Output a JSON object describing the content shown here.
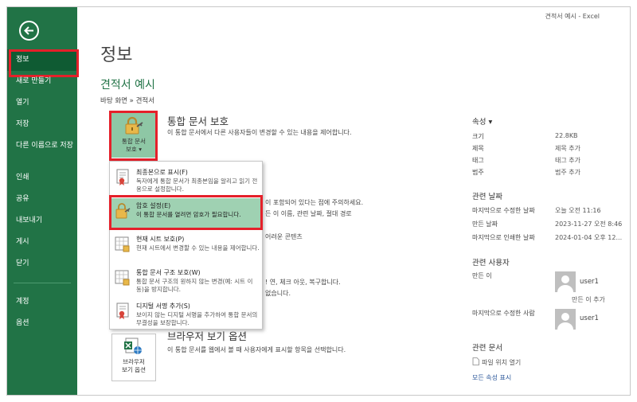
{
  "window": {
    "title": "견적서 예시  -  Excel"
  },
  "sidebar": {
    "items": [
      {
        "label": "정보"
      },
      {
        "label": "새로 만들기"
      },
      {
        "label": "열기"
      },
      {
        "label": "저장"
      },
      {
        "label": "다른 이름으로 저장"
      },
      {
        "label": "인쇄"
      },
      {
        "label": "공유"
      },
      {
        "label": "내보내기"
      },
      {
        "label": "게시"
      },
      {
        "label": "닫기"
      },
      {
        "label": "계정"
      },
      {
        "label": "옵션"
      }
    ]
  },
  "main": {
    "title": "정보",
    "doc_name": "견적서 예시",
    "doc_path": "바탕 화면 » 견적서",
    "protect": {
      "title": "통합 문서 보호",
      "desc": "이 통합 문서에서 다른 사용자들이 변경할 수 있는 내용을 제어합니다.",
      "button_line1": "통합 문서",
      "button_line2": "보호 ▾"
    },
    "hidden_text": {
      "line1": "이 포함되어 있다는 점에 주의하세요.",
      "line2": "든 이 이름, 관련 날짜, 절대 경로",
      "line3": "어려운 콘텐츠",
      "line4": "! 연, 체크 아웃, 복구합니다.",
      "line5": "없습니다."
    },
    "browser": {
      "title": "브라우저 보기 옵션",
      "desc": "이 통합 문서를 웹에서 볼 때 사용자에게 표시할 항목을 선택합니다.",
      "button_line1": "브라우저",
      "button_line2": "보기 옵션"
    }
  },
  "menu": {
    "items": [
      {
        "title": "최종본으로 표시(F)",
        "desc": "독자에게 통합 문서가 최종본임을 알리고 읽기 전용으로 설정합니다."
      },
      {
        "title": "암호 설정(E)",
        "desc": "이 통합 문서를 열려면 암호가 필요합니다."
      },
      {
        "title": "현재 시트 보호(P)",
        "desc": "현재 시트에서 변경할 수 있는 내용을 제어합니다."
      },
      {
        "title": "통합 문서 구조 보호(W)",
        "desc": "통합 문서 구조의 원하지 않는 변경(예: 시트 이동)을 방지합니다."
      },
      {
        "title": "디지털 서명 추가(S)",
        "desc": "보이지 않는 디지털 서명을 추가하여 통합 문서의 무결성을 보장합니다."
      }
    ]
  },
  "properties": {
    "head": "속성 ▾",
    "rows": [
      {
        "label": "크기",
        "value": "22.8KB"
      },
      {
        "label": "제목",
        "value": "제목 추가"
      },
      {
        "label": "태그",
        "value": "태그 추가"
      },
      {
        "label": "범주",
        "value": "범주 추가"
      }
    ]
  },
  "dates": {
    "head": "관련 날짜",
    "rows": [
      {
        "label": "마지막으로 수정한 날짜",
        "value": "오늘 오전 11:16"
      },
      {
        "label": "만든 날짜",
        "value": "2023-11-27 오전 8:46"
      },
      {
        "label": "마지막으로 인쇄한 날짜",
        "value": "2024-01-04 오후 12..."
      }
    ]
  },
  "people": {
    "head": "관련 사용자",
    "author_label": "만든 이",
    "author_name": "user1",
    "add_author": "만든 이 추가",
    "modified_label": "마지막으로 수정한 사람",
    "modified_name": "user1"
  },
  "docs": {
    "head": "관련 문서",
    "open_location": "파일 위치 열기",
    "show_all": "모든 속성 표시"
  }
}
